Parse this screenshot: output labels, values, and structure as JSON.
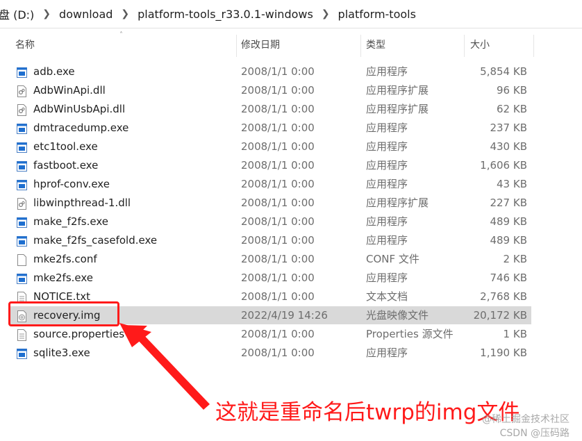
{
  "breadcrumb": {
    "items": [
      "盘 (D:)",
      "download",
      "platform-tools_r33.0.1-windows",
      "platform-tools"
    ]
  },
  "columns": {
    "name": "名称",
    "date": "修改日期",
    "type": "类型",
    "size": "大小"
  },
  "files": [
    {
      "name": "adb.exe",
      "date": "2008/1/1 0:00",
      "type": "应用程序",
      "size": "5,854 KB",
      "icon": "exe-icon"
    },
    {
      "name": "AdbWinApi.dll",
      "date": "2008/1/1 0:00",
      "type": "应用程序扩展",
      "size": "96 KB",
      "icon": "dll-icon"
    },
    {
      "name": "AdbWinUsbApi.dll",
      "date": "2008/1/1 0:00",
      "type": "应用程序扩展",
      "size": "62 KB",
      "icon": "dll-icon"
    },
    {
      "name": "dmtracedump.exe",
      "date": "2008/1/1 0:00",
      "type": "应用程序",
      "size": "237 KB",
      "icon": "exe-icon"
    },
    {
      "name": "etc1tool.exe",
      "date": "2008/1/1 0:00",
      "type": "应用程序",
      "size": "430 KB",
      "icon": "exe-icon"
    },
    {
      "name": "fastboot.exe",
      "date": "2008/1/1 0:00",
      "type": "应用程序",
      "size": "1,606 KB",
      "icon": "exe-icon"
    },
    {
      "name": "hprof-conv.exe",
      "date": "2008/1/1 0:00",
      "type": "应用程序",
      "size": "43 KB",
      "icon": "exe-icon"
    },
    {
      "name": "libwinpthread-1.dll",
      "date": "2008/1/1 0:00",
      "type": "应用程序扩展",
      "size": "227 KB",
      "icon": "dll-icon"
    },
    {
      "name": "make_f2fs.exe",
      "date": "2008/1/1 0:00",
      "type": "应用程序",
      "size": "489 KB",
      "icon": "exe-icon"
    },
    {
      "name": "make_f2fs_casefold.exe",
      "date": "2008/1/1 0:00",
      "type": "应用程序",
      "size": "489 KB",
      "icon": "exe-icon"
    },
    {
      "name": "mke2fs.conf",
      "date": "2008/1/1 0:00",
      "type": "CONF 文件",
      "size": "2 KB",
      "icon": "blank-file-icon"
    },
    {
      "name": "mke2fs.exe",
      "date": "2008/1/1 0:00",
      "type": "应用程序",
      "size": "746 KB",
      "icon": "exe-icon"
    },
    {
      "name": "NOTICE.txt",
      "date": "2008/1/1 0:00",
      "type": "文本文档",
      "size": "2,768 KB",
      "icon": "text-file-icon"
    },
    {
      "name": "recovery.img",
      "date": "2022/4/19 14:26",
      "type": "光盘映像文件",
      "size": "20,172 KB",
      "icon": "disc-image-icon",
      "selected": true
    },
    {
      "name": "source.properties",
      "date": "2008/1/1 0:00",
      "type": "Properties 源文件",
      "size": "1 KB",
      "icon": "text-file-icon"
    },
    {
      "name": "sqlite3.exe",
      "date": "2008/1/1 0:00",
      "type": "应用程序",
      "size": "1,190 KB",
      "icon": "exe-icon"
    }
  ],
  "annotation": {
    "text": "这就是重命名后twrp的img文件",
    "color": "#ff1a1a"
  },
  "watermark": {
    "line1": "@稀土掘金技术社区",
    "line2": "CSDN @压码路"
  },
  "colors": {
    "selected_row": "#d9d9d9",
    "annotation_red": "#ff1a1a",
    "exe_icon_blue": "#1e6fd0"
  }
}
